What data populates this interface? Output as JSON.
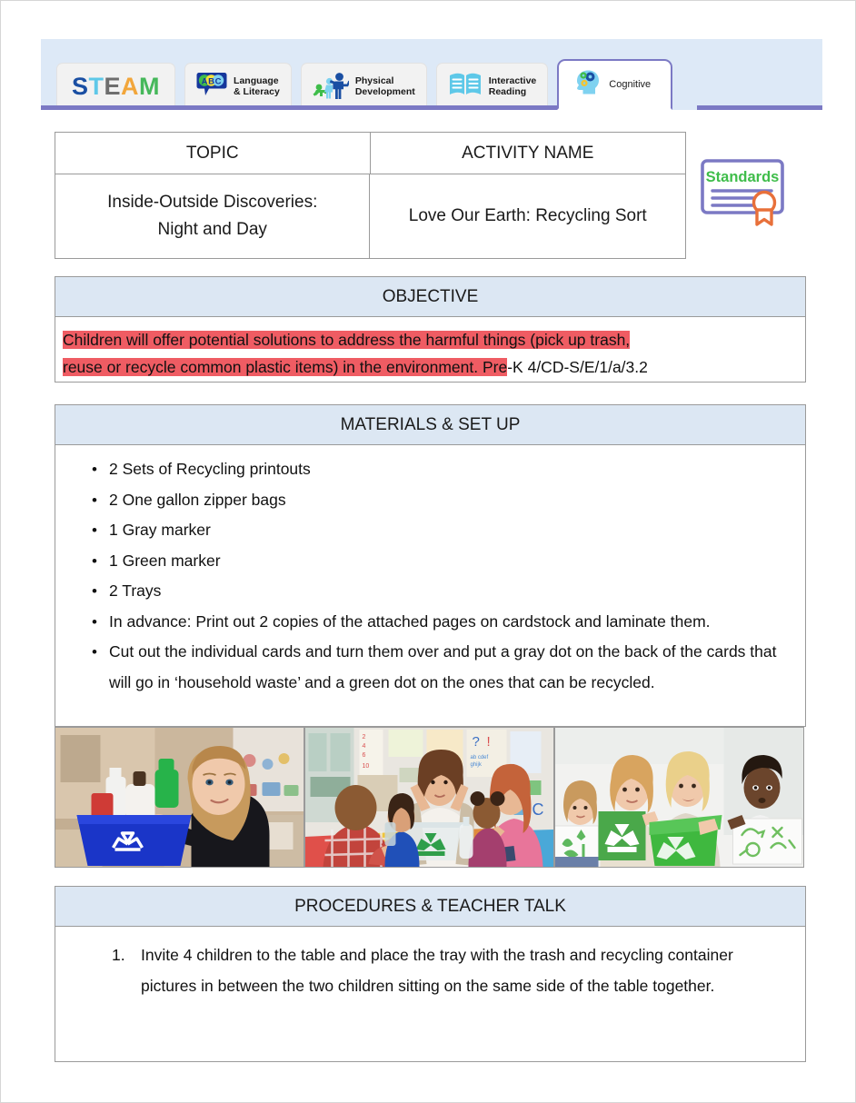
{
  "tabs": [
    {
      "label": "STEAM",
      "icon": "steam-wordmark-icon",
      "active": false,
      "letters": [
        {
          "ch": "S",
          "color": "#1a4fa3"
        },
        {
          "ch": "T",
          "color": "#5ec8e8"
        },
        {
          "ch": "E",
          "color": "#6e6e6e"
        },
        {
          "ch": "A",
          "color": "#f2a63b"
        },
        {
          "ch": "M",
          "color": "#46b85b"
        }
      ]
    },
    {
      "label": "Language\n& Literacy",
      "icon": "abc-speech-bubble-icon",
      "active": false
    },
    {
      "label": "Physical\nDevelopment",
      "icon": "children-figures-icon",
      "active": false
    },
    {
      "label": "Interactive\nReading",
      "icon": "open-book-icon",
      "active": false
    },
    {
      "label": "Cognitive",
      "icon": "brain-gears-icon",
      "active": true
    }
  ],
  "info_table": {
    "headers": [
      "TOPIC",
      "ACTIVITY NAME"
    ],
    "values": [
      "Inside-Outside Discoveries:\nNight and Day",
      "Love Our Earth: Recycling Sort"
    ]
  },
  "standards_badge": {
    "label": "Standards",
    "icon": "certificate-ribbon-icon",
    "border_color": "#7b79c4",
    "text_color": "#3fbd4a",
    "ribbon_color": "#e8703a"
  },
  "objective": {
    "header": "OBJECTIVE",
    "line1_highlighted": "Children will offer potential solutions to address the harmful things (pick up trash,",
    "line2_highlighted": "reuse or recycle common plastic items) in the environment. Pre",
    "line2_plain": "-K 4/CD-S/E/1/a/3.2",
    "highlight_color": "#ef5c63"
  },
  "materials": {
    "header": "MATERIALS & SET UP",
    "items": [
      "2 Sets of Recycling printouts",
      "2 One gallon zipper bags",
      "1 Gray marker",
      "1 Green marker",
      "2 Trays",
      "In advance: Print out 2 copies of the attached pages on cardstock and laminate them.",
      "Cut out the individual cards and turn them over and put a gray dot on the back of the cards that will go in ‘household waste’ and a green dot on the ones that can be recycled."
    ]
  },
  "photos": [
    {
      "alt": "Girl holding a blue recycling bin filled with bottles in a kitchen",
      "name": "photo-girl-blue-recycling-bin"
    },
    {
      "alt": "Teacher and children sorting recyclables into a clear bin in a classroom",
      "name": "photo-classroom-recycling-lesson"
    },
    {
      "alt": "Four children holding green recycling posters and a green bin",
      "name": "photo-children-green-recycling-posters"
    }
  ],
  "procedures": {
    "header": "PROCEDURES & TEACHER TALK",
    "steps": [
      "Invite 4 children to the table and place the tray with the trash and recycling container pictures in between the two children sitting on the same side of the table together."
    ]
  },
  "colors": {
    "tabbar_bg": "#dde9f7",
    "tab_accent": "#7b79c4",
    "section_header_bg": "#dce7f3",
    "table_border": "#9a9a9a"
  }
}
